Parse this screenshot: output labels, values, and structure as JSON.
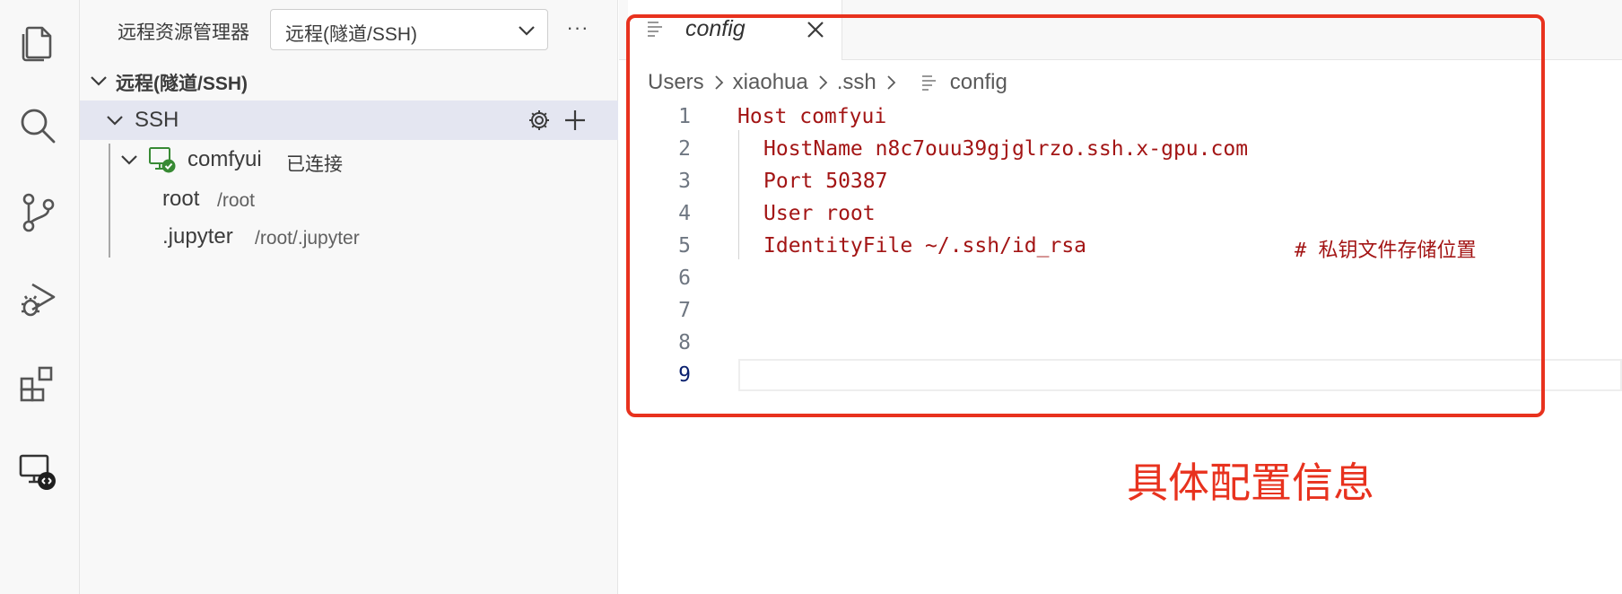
{
  "activity_bar": {
    "icons": [
      "files-icon",
      "search-icon",
      "source-control-icon",
      "run-debug-icon",
      "extensions-icon",
      "remote-explorer-icon"
    ]
  },
  "sidebar": {
    "title": "远程资源管理器",
    "select_value": "远程(隧道/SSH)",
    "more_label": "···",
    "section_title": "远程(隧道/SSH)",
    "group_label": "SSH",
    "host": {
      "name": "comfyui",
      "status": "已连接"
    },
    "folders": [
      {
        "name": "root",
        "path": "/root"
      },
      {
        "name": ".jupyter",
        "path": "/root/.jupyter"
      }
    ]
  },
  "editor": {
    "tab_label": "config",
    "breadcrumb": [
      "Users",
      "xiaohua",
      ".ssh",
      "config"
    ],
    "lines": [
      {
        "num": "1",
        "text": "Host comfyui",
        "comment": ""
      },
      {
        "num": "2",
        "text": "HostName n8c7ouu39gjglrzo.ssh.x-gpu.com",
        "comment": ""
      },
      {
        "num": "3",
        "text": "Port 50387",
        "comment": ""
      },
      {
        "num": "4",
        "text": "User root",
        "comment": ""
      },
      {
        "num": "5",
        "text": "IdentityFile ~/.ssh/id_rsa",
        "comment": "# 私钥文件存储位置"
      },
      {
        "num": "6",
        "text": "",
        "comment": ""
      },
      {
        "num": "7",
        "text": "",
        "comment": ""
      },
      {
        "num": "8",
        "text": "",
        "comment": ""
      },
      {
        "num": "9",
        "text": "",
        "comment": ""
      }
    ],
    "active_line": "9"
  },
  "annotation": {
    "text": "具体配置信息",
    "color": "#e8321e"
  },
  "colors": {
    "code_text": "#a31515",
    "connected_badge": "#388a34",
    "selection_bg": "#e4e6f1"
  }
}
